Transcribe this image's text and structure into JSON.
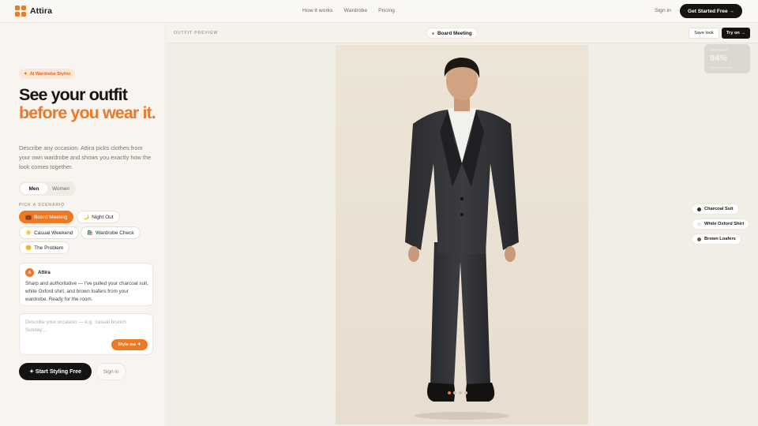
{
  "brand": {
    "name": "Attira",
    "accent": "#ef7822"
  },
  "nav": {
    "links": [
      "How it works",
      "Wardrobe",
      "Pricing"
    ],
    "signin": "Sign in",
    "cta": "Get Started Free →"
  },
  "hero": {
    "tag": "AI Wardrobe Stylist",
    "title_line1": "See your outfit",
    "title_line2": "before you wear it.",
    "description": "Describe any occasion. Attira picks clothes from your own wardrobe and shows you exactly how the look comes together."
  },
  "gender": {
    "options": [
      "Men",
      "Women"
    ],
    "selected": "Men"
  },
  "scenarios": {
    "label": "PICK A SCENARIO",
    "items": [
      {
        "icon": "💼",
        "label": "Board Meeting"
      },
      {
        "icon": "🌙",
        "label": "Night Out"
      },
      {
        "icon": "☀️",
        "label": "Casual Weekend"
      },
      {
        "icon": "🛍️",
        "label": "Wardrobe Check"
      },
      {
        "icon": "😕",
        "label": "The Problem"
      }
    ],
    "selected": "Board Meeting"
  },
  "chat": {
    "avatar": "A",
    "name": "Attira",
    "message": "Sharp and authoritative — I've pulled your charcoal suit, white Oxford shirt, and brown loafers from your wardrobe. Ready for the room."
  },
  "input": {
    "placeholder": "Describe your occasion — e.g. 'casual brunch Sunday'...",
    "button": "Style me ✦"
  },
  "actions": {
    "start": "✦ Start Styling Free",
    "signin": "Sign in"
  },
  "preview": {
    "label": "OUTFIT PREVIEW",
    "scenario": "Board Meeting",
    "save": "Save look",
    "tryon": "Try on →",
    "score_title": "Style Match",
    "score_value": "94%",
    "score_sub": "Occasion-ready",
    "items": [
      {
        "label": "Charcoal Suit",
        "color": "#2f3033"
      },
      {
        "label": "White Oxford Shirt",
        "color": "#f2f0ec"
      },
      {
        "label": "Brown Loafers",
        "color": "#7a5a2e"
      }
    ],
    "slides_total": 4,
    "slide_active": 1
  }
}
